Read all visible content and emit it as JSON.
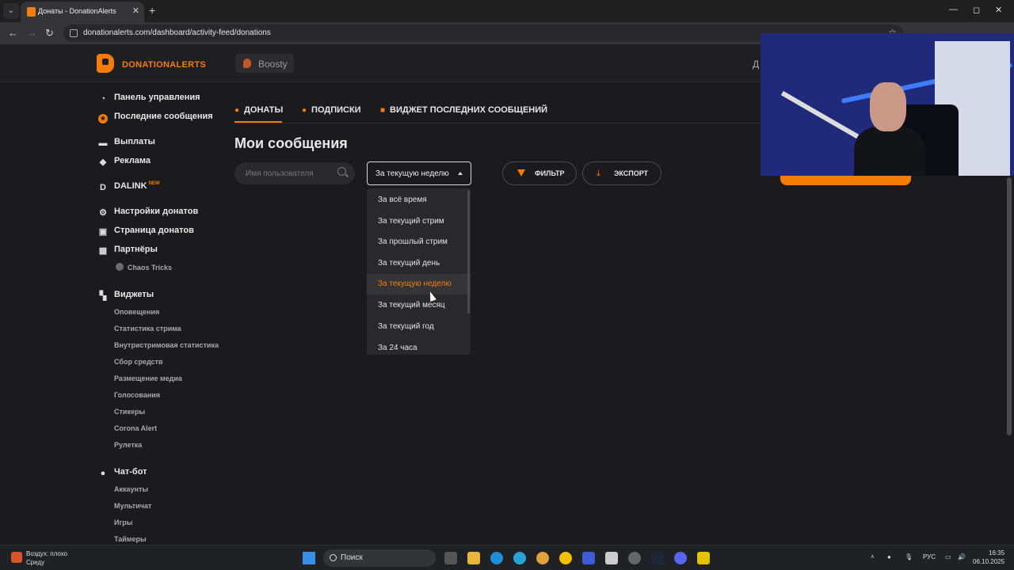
{
  "browser": {
    "tab_title": "Донаты - DonationAlerts",
    "url": "donationalerts.com/dashboard/activity-feed/donations"
  },
  "header": {
    "logo_text": "DONATIONALERTS",
    "boosty_label": "Boosty",
    "right_cut_text": "Д"
  },
  "sidebar": {
    "items": [
      {
        "label": "Панель управления"
      },
      {
        "label": "Последние сообщения"
      },
      {
        "label": "Выплаты"
      },
      {
        "label": "Реклама"
      },
      {
        "label": "DALINK",
        "badge": "NEW"
      },
      {
        "label": "Настройки донатов"
      },
      {
        "label": "Страница донатов"
      },
      {
        "label": "Партнёры"
      },
      {
        "label": "Виджеты"
      },
      {
        "label": "Чат-бот"
      }
    ],
    "partners": [
      "Chaos Tricks"
    ],
    "widgets": [
      "Оповещения",
      "Статистика стрима",
      "Внутристримовая статистика",
      "Сбор средств",
      "Размещение медиа",
      "Голосования",
      "Стикеры",
      "Corona Alert",
      "Рулетка"
    ],
    "chatbot": [
      "Аккаунты",
      "Мультичат",
      "Игры",
      "Таймеры"
    ]
  },
  "main": {
    "tabs": [
      {
        "label": "ДОНАТЫ"
      },
      {
        "label": "ПОДПИСКИ"
      },
      {
        "label": "ВИДЖЕТ ПОСЛЕДНИХ СООБЩЕНИЙ"
      }
    ],
    "title": "Мои сообщения",
    "search_placeholder": "Имя пользователя",
    "period_value": "За текущую неделю",
    "filter_label": "ФИЛЬТР",
    "export_label": "ЭКСПОРТ",
    "period_options": [
      "За всё время",
      "За текущий стрим",
      "За прошлый стрим",
      "За текущий день",
      "За текущую неделю",
      "За текущий месяц",
      "За текущий год",
      "За 24 часа"
    ]
  },
  "taskbar": {
    "weather_title": "Воздух: плохо",
    "weather_sub": "Среду",
    "search_label": "Поиск",
    "lang": "РУС",
    "time": "16:35",
    "date": "06.10.2025"
  },
  "colors": {
    "accent": "#f57d07",
    "background": "#1b1b1d"
  }
}
